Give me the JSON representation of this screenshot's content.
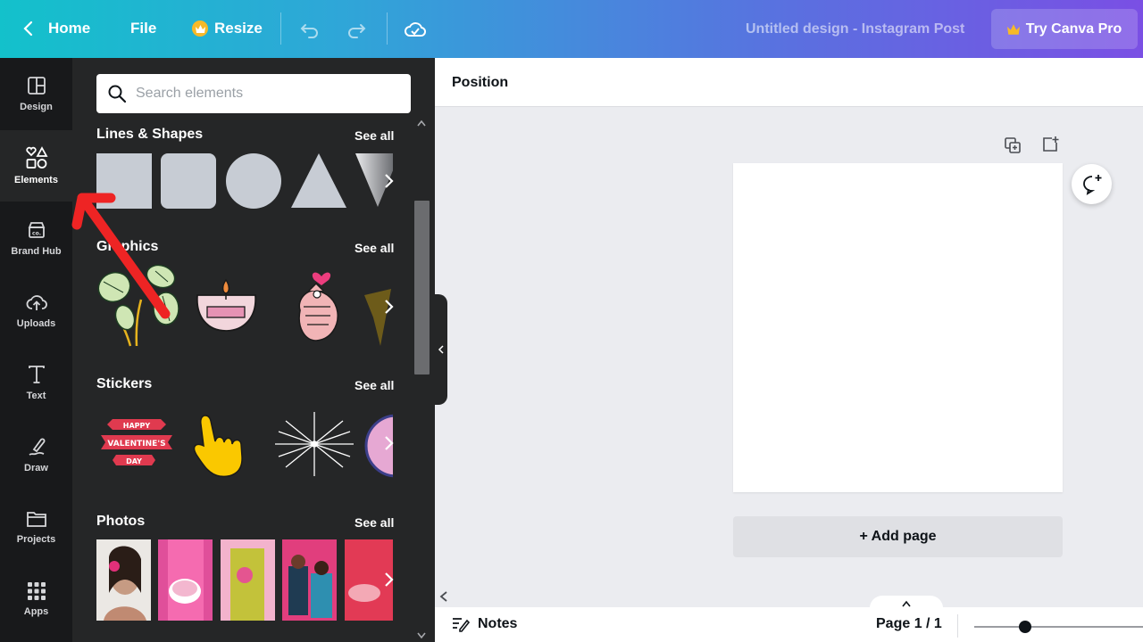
{
  "topbar": {
    "home_label": "Home",
    "file_label": "File",
    "resize_label": "Resize",
    "title": "Untitled design - Instagram Post",
    "pro_label": "Try Canva Pro",
    "gradient_start": "#13c1cb",
    "gradient_end": "#7a4fe4"
  },
  "rail": {
    "items": [
      {
        "label": "Design",
        "icon": "layout-icon"
      },
      {
        "label": "Elements",
        "icon": "shapes-icon"
      },
      {
        "label": "Brand Hub",
        "icon": "brand-icon"
      },
      {
        "label": "Uploads",
        "icon": "upload-cloud-icon"
      },
      {
        "label": "Text",
        "icon": "text-icon"
      },
      {
        "label": "Draw",
        "icon": "pen-icon"
      },
      {
        "label": "Projects",
        "icon": "folder-icon"
      },
      {
        "label": "Apps",
        "icon": "grid-icon"
      }
    ],
    "active": "Elements"
  },
  "panel": {
    "search_placeholder": "Search elements",
    "see_all": "See all",
    "sections": {
      "lines": "Lines & Shapes",
      "graphics": "Graphics",
      "stickers": "Stickers",
      "photos": "Photos"
    },
    "sticker_text": "HAPPY VALENTINE'S DAY"
  },
  "canvas": {
    "ctx_label": "Position",
    "add_page": "+ Add page",
    "notes": "Notes",
    "page_info": "Page 1 / 1",
    "zoom_fraction": 0.3
  }
}
